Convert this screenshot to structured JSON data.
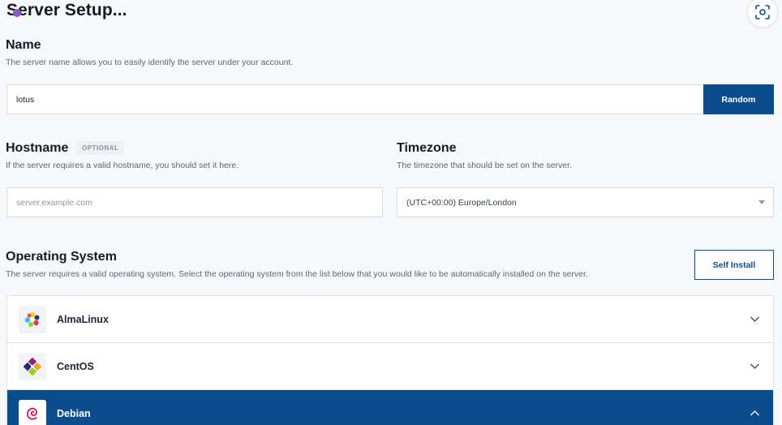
{
  "page": {
    "title": "Server Setup..."
  },
  "name_section": {
    "heading": "Name",
    "description": "The server name allows you to easily identify the server under your account.",
    "value": "lotus",
    "random_label": "Random"
  },
  "hostname_section": {
    "heading": "Hostname",
    "badge": "OPTIONAL",
    "description": "If the server requires a valid hostname, you should set it here.",
    "placeholder": "server.example.com",
    "value": ""
  },
  "timezone_section": {
    "heading": "Timezone",
    "description": "The timezone that should be set on the server.",
    "selected": "(UTC+00:00) Europe/London"
  },
  "os_section": {
    "heading": "Operating System",
    "description": "The server requires a valid operating system. Select the operating system from the list below that you would like to be automatically installed on the server.",
    "self_install_label": "Self Install",
    "items": [
      {
        "name": "AlmaLinux",
        "icon": "almalinux-logo-icon",
        "expanded": false
      },
      {
        "name": "CentOS",
        "icon": "centos-logo-icon",
        "expanded": false
      },
      {
        "name": "Debian",
        "icon": "debian-logo-icon",
        "expanded": true
      }
    ]
  },
  "colors": {
    "primary": "#0b4d8c",
    "background": "#f7f8fa",
    "cursor": "#8a5cc0"
  }
}
